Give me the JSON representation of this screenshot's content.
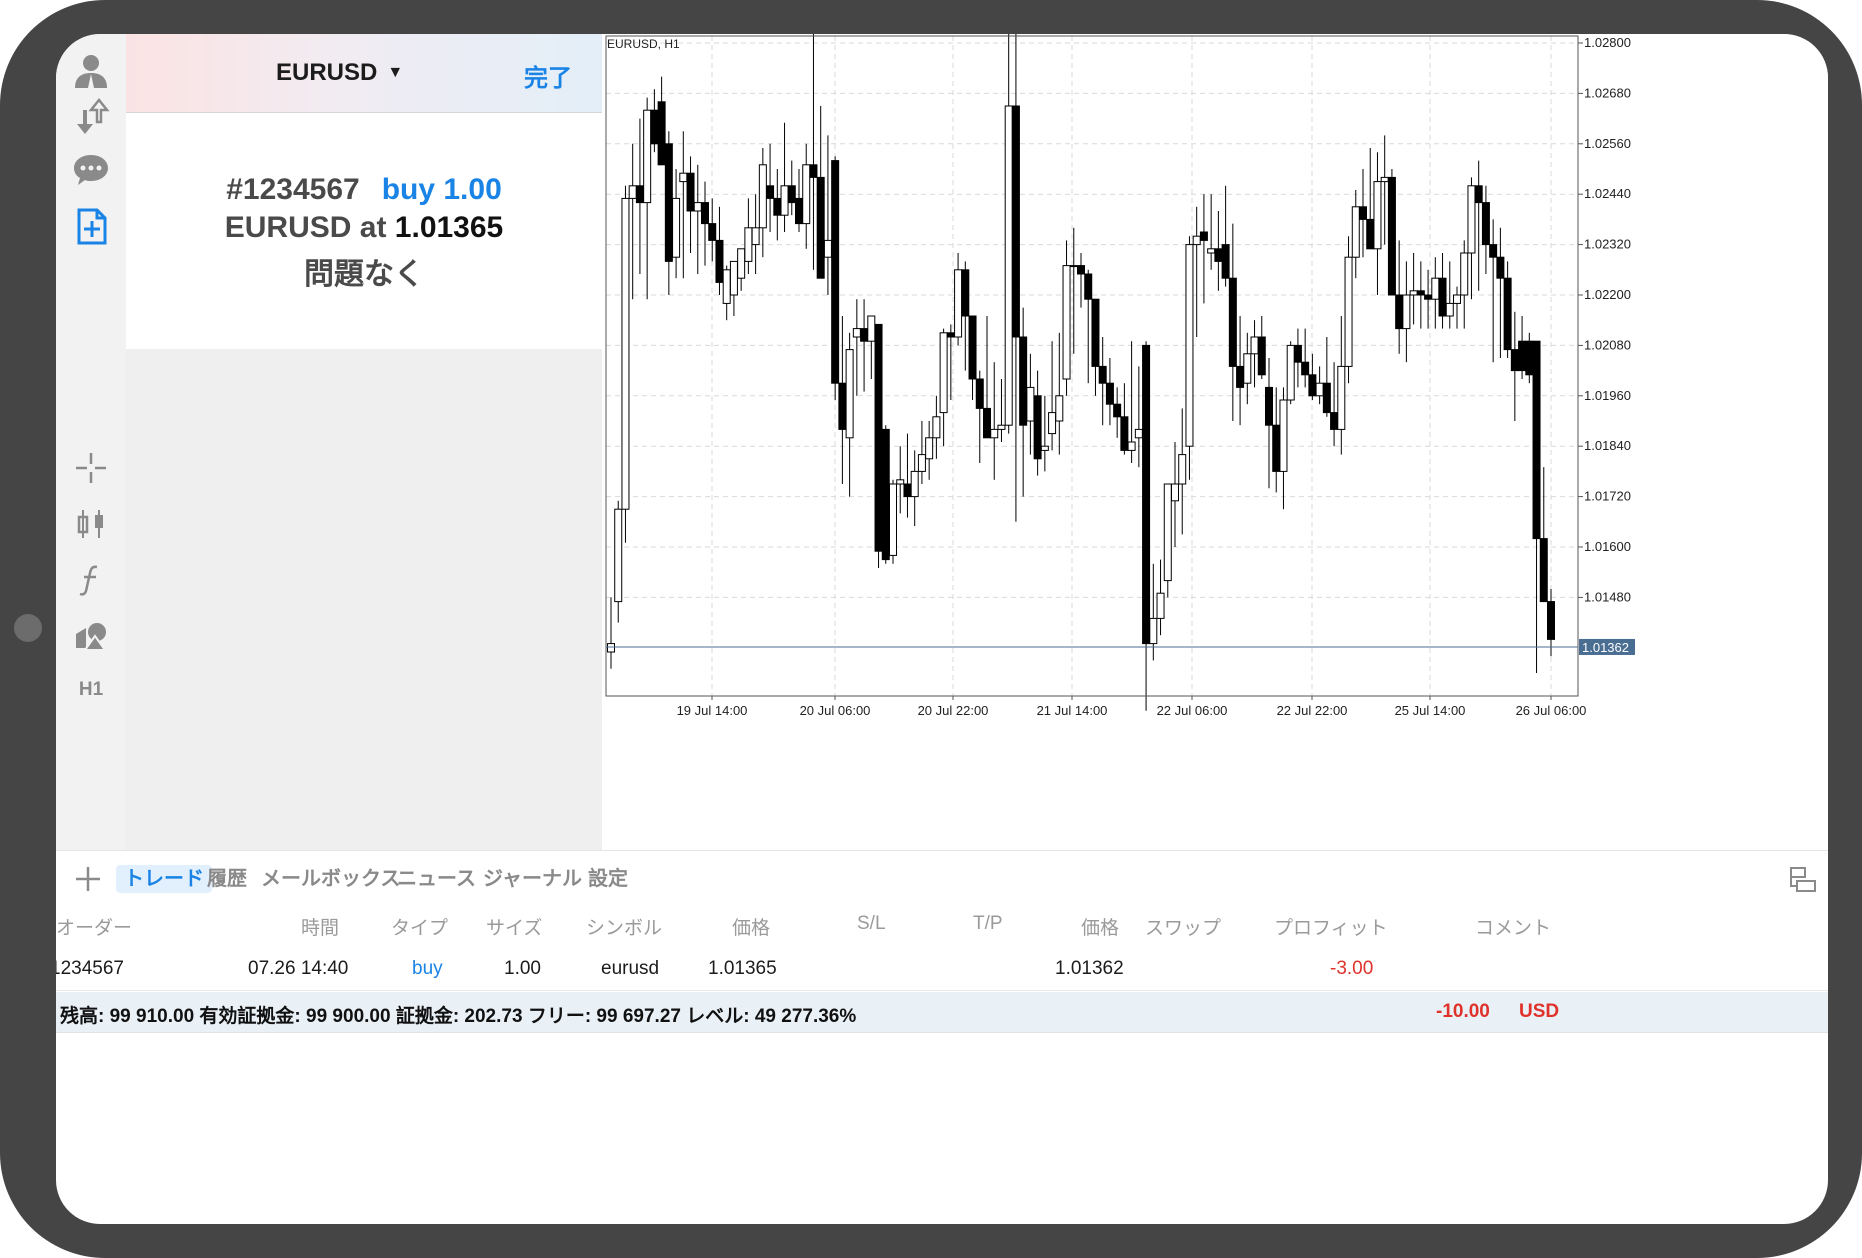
{
  "sidebar": {
    "timeframe_label": "H1",
    "icons": [
      "account-icon",
      "trade-transfer-icon",
      "chat-icon",
      "new-order-icon",
      "crosshair-icon",
      "indicators-icon",
      "function-icon",
      "objects-icon",
      "timeframe-icon"
    ]
  },
  "order_panel": {
    "symbol": "EURUSD",
    "caret": "▼",
    "done_label": "完了",
    "ticket": "#1234567",
    "action": "buy 1.00",
    "symbol_at": "EURUSD at",
    "price": "1.01365",
    "status": "問題なく"
  },
  "chart": {
    "title": "EURUSD, H1",
    "current_price_label": "1.01362"
  },
  "chart_data": {
    "type": "candlestick",
    "title": "EURUSD, H1",
    "y_ticks": [
      "1.02800",
      "1.02680",
      "1.02560",
      "1.02440",
      "1.02320",
      "1.02200",
      "1.02080",
      "1.01960",
      "1.01840",
      "1.01720",
      "1.01600",
      "1.01480"
    ],
    "ylim": [
      1.0124,
      1.028
    ],
    "x_ticks": [
      "19 Jul 14:00",
      "20 Jul 06:00",
      "20 Jul 22:00",
      "21 Jul 14:00",
      "22 Jul 06:00",
      "22 Jul 22:00",
      "25 Jul 14:00",
      "26 Jul 06:00"
    ],
    "current_price": 1.01362,
    "grid": true,
    "candles": [
      [
        1.0135,
        1.0148,
        1.0131,
        1.0137
      ],
      [
        1.0147,
        1.0171,
        1.0142,
        1.0169
      ],
      [
        1.0169,
        1.0246,
        1.0161,
        1.0243
      ],
      [
        1.0243,
        1.0256,
        1.0219,
        1.0246
      ],
      [
        1.0246,
        1.0262,
        1.0225,
        1.0242
      ],
      [
        1.0242,
        1.0267,
        1.0219,
        1.0264
      ],
      [
        1.0264,
        1.0269,
        1.0254,
        1.0256
      ],
      [
        1.0266,
        1.0272,
        1.0252,
        1.0251
      ],
      [
        1.0256,
        1.0259,
        1.022,
        1.0228
      ],
      [
        1.0229,
        1.025,
        1.0224,
        1.0243
      ],
      [
        1.0247,
        1.0259,
        1.0224,
        1.0249
      ],
      [
        1.0249,
        1.0253,
        1.023,
        1.024
      ],
      [
        1.024,
        1.0251,
        1.0225,
        1.0242
      ],
      [
        1.0242,
        1.0247,
        1.0227,
        1.0237
      ],
      [
        1.0237,
        1.0243,
        1.0228,
        1.0233
      ],
      [
        1.0233,
        1.0241,
        1.022,
        1.0223
      ],
      [
        1.0218,
        1.0227,
        1.0214,
        1.0226
      ],
      [
        1.022,
        1.0227,
        1.0215,
        1.0228
      ],
      [
        1.0224,
        1.0231,
        1.0221,
        1.0231
      ],
      [
        1.0228,
        1.0243,
        1.0225,
        1.0236
      ],
      [
        1.0232,
        1.0244,
        1.0225,
        1.0236
      ],
      [
        1.0236,
        1.0255,
        1.0229,
        1.0251
      ],
      [
        1.0246,
        1.0256,
        1.0235,
        1.0243
      ],
      [
        1.0243,
        1.025,
        1.0233,
        1.0239
      ],
      [
        1.0239,
        1.0261,
        1.0235,
        1.0246
      ],
      [
        1.0246,
        1.0252,
        1.0239,
        1.0242
      ],
      [
        1.0243,
        1.025,
        1.0235,
        1.0237
      ],
      [
        1.0237,
        1.0256,
        1.0231,
        1.0251
      ],
      [
        1.0251,
        1.0287,
        1.0226,
        1.0248
      ],
      [
        1.0248,
        1.0265,
        1.0226,
        1.0224
      ],
      [
        1.0229,
        1.0258,
        1.022,
        1.0233
      ],
      [
        1.0252,
        1.0253,
        1.0195,
        1.0199
      ],
      [
        1.0199,
        1.0215,
        1.0175,
        1.0188
      ],
      [
        1.0186,
        1.0211,
        1.0172,
        1.0207
      ],
      [
        1.021,
        1.0219,
        1.0196,
        1.0212
      ],
      [
        1.0212,
        1.0219,
        1.0197,
        1.0209
      ],
      [
        1.0209,
        1.0215,
        1.02,
        1.0215
      ],
      [
        1.0213,
        1.0213,
        1.0155,
        1.0159
      ],
      [
        1.0188,
        1.0189,
        1.0156,
        1.0157
      ],
      [
        1.0158,
        1.0176,
        1.0156,
        1.0175
      ],
      [
        1.0175,
        1.0184,
        1.0168,
        1.0176
      ],
      [
        1.0175,
        1.0187,
        1.0167,
        1.0172
      ],
      [
        1.0172,
        1.0183,
        1.0165,
        1.0178
      ],
      [
        1.0178,
        1.019,
        1.0175,
        1.0182
      ],
      [
        1.0181,
        1.019,
        1.0176,
        1.0186
      ],
      [
        1.0186,
        1.0196,
        1.0181,
        1.0191
      ],
      [
        1.0192,
        1.0212,
        1.0184,
        1.0211
      ],
      [
        1.0211,
        1.0213,
        1.0195,
        1.021
      ],
      [
        1.021,
        1.023,
        1.0208,
        1.0226
      ],
      [
        1.0226,
        1.0228,
        1.0202,
        1.0215
      ],
      [
        1.0215,
        1.0214,
        1.0195,
        1.02
      ],
      [
        1.02,
        1.0202,
        1.018,
        1.0193
      ],
      [
        1.0193,
        1.0215,
        1.0186,
        1.0186
      ],
      [
        1.0186,
        1.0204,
        1.0176,
        1.0188
      ],
      [
        1.0188,
        1.02,
        1.0185,
        1.0189
      ],
      [
        1.0189,
        1.0287,
        1.0187,
        1.0265
      ],
      [
        1.0265,
        1.0283,
        1.0166,
        1.021
      ],
      [
        1.021,
        1.0217,
        1.0172,
        1.0189
      ],
      [
        1.019,
        1.0206,
        1.0182,
        1.0198
      ],
      [
        1.0196,
        1.0202,
        1.0177,
        1.0181
      ],
      [
        1.0183,
        1.0196,
        1.0178,
        1.0184
      ],
      [
        1.0187,
        1.0209,
        1.0183,
        1.0192
      ],
      [
        1.019,
        1.0211,
        1.0182,
        1.0196
      ],
      [
        1.02,
        1.0233,
        1.0196,
        1.0227
      ],
      [
        1.0227,
        1.0236,
        1.0206,
        1.0227
      ],
      [
        1.0227,
        1.023,
        1.0217,
        1.0225
      ],
      [
        1.0225,
        1.0226,
        1.0199,
        1.0219
      ],
      [
        1.0219,
        1.0216,
        1.0196,
        1.0203
      ],
      [
        1.0203,
        1.021,
        1.0189,
        1.0199
      ],
      [
        1.0199,
        1.0205,
        1.0189,
        1.0194
      ],
      [
        1.0194,
        1.0198,
        1.0186,
        1.0191
      ],
      [
        1.0191,
        1.0199,
        1.0182,
        1.0183
      ],
      [
        1.0183,
        1.0209,
        1.018,
        1.0185
      ],
      [
        1.0186,
        1.0203,
        1.0179,
        1.0188
      ],
      [
        1.0208,
        1.0209,
        1.0121,
        1.0137
      ],
      [
        1.0137,
        1.0156,
        1.0133,
        1.0143
      ],
      [
        1.0143,
        1.0157,
        1.0139,
        1.0149
      ],
      [
        1.0152,
        1.0174,
        1.0148,
        1.0175
      ],
      [
        1.0171,
        1.0185,
        1.016,
        1.0175
      ],
      [
        1.0175,
        1.0193,
        1.0163,
        1.0182
      ],
      [
        1.0184,
        1.0234,
        1.0176,
        1.0232
      ],
      [
        1.0232,
        1.0241,
        1.021,
        1.0234
      ],
      [
        1.0235,
        1.0244,
        1.0218,
        1.0233
      ],
      [
        1.023,
        1.0244,
        1.0226,
        1.0231
      ],
      [
        1.0231,
        1.024,
        1.0221,
        1.0228
      ],
      [
        1.0232,
        1.0246,
        1.0222,
        1.0224
      ],
      [
        1.0224,
        1.0237,
        1.019,
        1.0203
      ],
      [
        1.0203,
        1.0215,
        1.0189,
        1.0198
      ],
      [
        1.0199,
        1.0211,
        1.0194,
        1.0206
      ],
      [
        1.0206,
        1.0214,
        1.0198,
        1.021
      ],
      [
        1.021,
        1.0215,
        1.02,
        1.0201
      ],
      [
        1.0198,
        1.0205,
        1.0174,
        1.0189
      ],
      [
        1.0189,
        1.0198,
        1.0173,
        1.0178
      ],
      [
        1.0178,
        1.0198,
        1.0169,
        1.0195
      ],
      [
        1.0195,
        1.0209,
        1.0194,
        1.0208
      ],
      [
        1.0208,
        1.0212,
        1.0198,
        1.0204
      ],
      [
        1.0204,
        1.0212,
        1.0198,
        1.0201
      ],
      [
        1.0201,
        1.0206,
        1.0195,
        1.0196
      ],
      [
        1.0196,
        1.0203,
        1.0194,
        1.0199
      ],
      [
        1.0199,
        1.021,
        1.0191,
        1.0192
      ],
      [
        1.0192,
        1.0204,
        1.0184,
        1.0188
      ],
      [
        1.0188,
        1.0215,
        1.0182,
        1.0203
      ],
      [
        1.0203,
        1.0234,
        1.0199,
        1.0229
      ],
      [
        1.0229,
        1.0245,
        1.0224,
        1.0241
      ],
      [
        1.0241,
        1.025,
        1.0229,
        1.0238
      ],
      [
        1.0238,
        1.0255,
        1.0232,
        1.0231
      ],
      [
        1.0231,
        1.0254,
        1.022,
        1.0247
      ],
      [
        1.0247,
        1.0258,
        1.0232,
        1.0248
      ],
      [
        1.0248,
        1.025,
        1.0222,
        1.022
      ],
      [
        1.022,
        1.0233,
        1.0206,
        1.0212
      ],
      [
        1.0212,
        1.0228,
        1.0204,
        1.022
      ],
      [
        1.022,
        1.023,
        1.0213,
        1.0221
      ],
      [
        1.0221,
        1.0228,
        1.0212,
        1.022
      ],
      [
        1.022,
        1.0226,
        1.0212,
        1.0219
      ],
      [
        1.0219,
        1.0229,
        1.0212,
        1.0224
      ],
      [
        1.0224,
        1.023,
        1.0212,
        1.0215
      ],
      [
        1.0215,
        1.0228,
        1.0212,
        1.0218
      ],
      [
        1.0218,
        1.0222,
        1.0212,
        1.022
      ],
      [
        1.022,
        1.0233,
        1.0212,
        1.023
      ],
      [
        1.023,
        1.0248,
        1.0219,
        1.0246
      ],
      [
        1.0246,
        1.0252,
        1.0221,
        1.0242
      ],
      [
        1.0242,
        1.0246,
        1.0225,
        1.0232
      ],
      [
        1.0232,
        1.0238,
        1.0204,
        1.0229
      ],
      [
        1.0229,
        1.0236,
        1.0205,
        1.0224
      ],
      [
        1.0224,
        1.0228,
        1.0205,
        1.0207
      ],
      [
        1.0207,
        1.0216,
        1.019,
        1.0202
      ],
      [
        1.0209,
        1.0215,
        1.02,
        1.0202
      ],
      [
        1.0209,
        1.0211,
        1.0199,
        1.0201
      ],
      [
        1.0209,
        1.0209,
        1.013,
        1.0162
      ],
      [
        1.0162,
        1.0179,
        1.015,
        1.0147
      ],
      [
        1.0147,
        1.015,
        1.0134,
        1.0138
      ]
    ]
  },
  "bottom_tabs": {
    "tabs": [
      "トレード",
      "履歴",
      "メールボックス",
      "ニュース",
      "ジャーナル",
      "設定"
    ],
    "active": "トレード"
  },
  "table": {
    "columns": [
      "オーダー",
      "時間",
      "タイプ",
      "サイズ",
      "シンボル",
      "価格",
      "S/L",
      "T/P",
      "価格",
      "スワップ",
      "プロフィット",
      "コメント"
    ],
    "row": {
      "order": "1234567",
      "time": "07.26 14:40",
      "type": "buy",
      "size": "1.00",
      "symbol": "eurusd",
      "price": "1.01365",
      "sl": "",
      "tp": "",
      "current_price": "1.01362",
      "swap": "",
      "profit": "-3.00",
      "comment": ""
    },
    "summary": {
      "text": "残高: 99 910.00 有効証拠金: 99 900.00 証拠金: 202.73 フリー: 99 697.27 レベル: 49 277.36%",
      "profit": "-10.00",
      "currency": "USD"
    }
  },
  "colors": {
    "accent": "#1a84e6",
    "loss": "#e0322b",
    "bezel": "#454545",
    "sidebar_bg": "#f2f2f2",
    "price_line": "#4a6d92"
  }
}
